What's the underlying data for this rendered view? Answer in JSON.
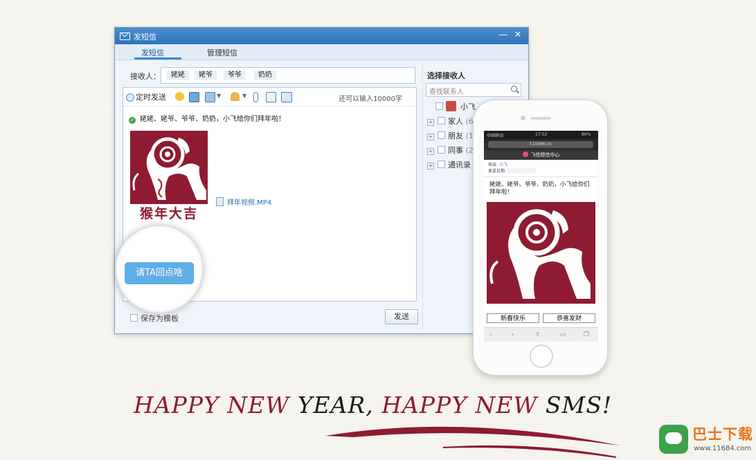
{
  "window": {
    "title": "发短信",
    "controls": {
      "minimize": "—",
      "close": "✕"
    },
    "tabs": [
      {
        "label": "发短信",
        "active": true
      },
      {
        "label": "管理短信",
        "active": false
      }
    ],
    "recipients_label": "接收人：",
    "recipients": [
      "姥姥",
      "姥爷",
      "爷爷",
      "奶奶"
    ],
    "toolbar": {
      "schedule_label": "定时发送",
      "counter": "还可以输入10000字",
      "icons": [
        "clock-icon",
        "emoji-icon",
        "image-icon",
        "screenshot-icon",
        "contact-card-icon",
        "attachment-icon",
        "template-icon",
        "book-icon"
      ]
    },
    "message_text": "姥姥、姥爷、爷爷、奶奶，小飞给你们拜年啦！",
    "card_caption": "猴年大吉",
    "attachment": "拜年视频.MP4",
    "save_template_label": "保存为模板",
    "send_label": "发送",
    "reply_button": "请TA回点啥"
  },
  "contacts_panel": {
    "title": "选择接收人",
    "search_placeholder": "查找联系人",
    "self_contact": "小飞",
    "groups": [
      {
        "label": "家人",
        "count": "(6)"
      },
      {
        "label": "朋友",
        "count": "(12"
      },
      {
        "label": "同事",
        "count": "(2"
      },
      {
        "label": "通讯录",
        "count": ""
      }
    ]
  },
  "phone": {
    "status_carrier": "中国移动",
    "status_time": "17:52",
    "status_battery": "86%",
    "url": "f.10086.cn",
    "app_title": "飞信短信中心",
    "from_label": "来自:",
    "from_value": "小飞",
    "date_label": "发送日期:",
    "message_text": "姥姥、姥爷、爷爷、奶奶，小飞给你们拜年啦！",
    "buttons": [
      "新春快乐",
      "恭喜发财"
    ]
  },
  "slogan": {
    "part1": "HAPPY NEW",
    "part2": "YEAR,",
    "part3": "HAPPY NEW",
    "part4": "SMS!"
  },
  "watermark": {
    "brand": "巴士下载",
    "url": "www.11684.com"
  },
  "colors": {
    "accent_red": "#8e1b32",
    "title_blue": "#2f72b9",
    "reply_blue": "#5faee6"
  }
}
